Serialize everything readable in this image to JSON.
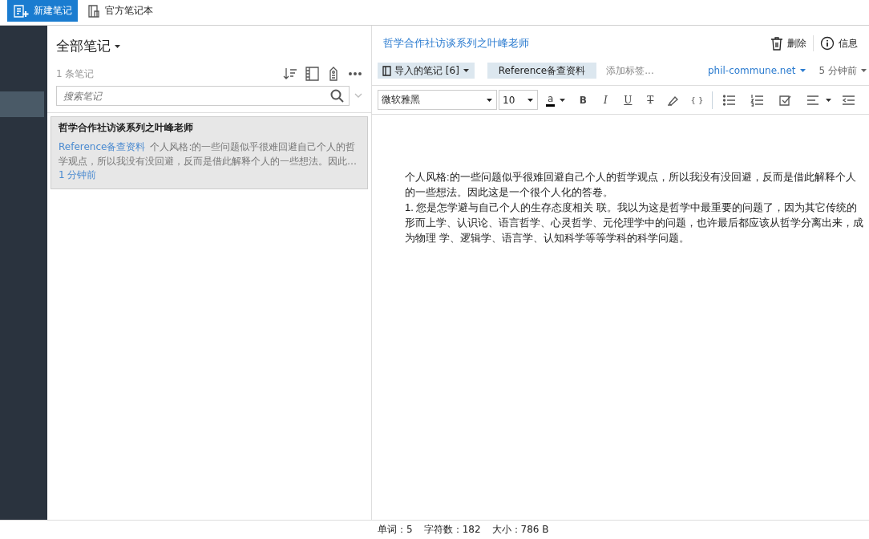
{
  "toolbar": {
    "new_note": "新建笔记",
    "notebooks": "官方笔记本"
  },
  "sidebar": {
    "items": [
      {
        "selected": true
      }
    ]
  },
  "note_list": {
    "title": "全部笔记",
    "count": "1 条笔记",
    "search": {
      "placeholder": "搜索笔记"
    },
    "notes": [
      {
        "title": "哲学合作社访谈系列之叶峰老师",
        "tag": "Reference备查资料",
        "snippet": "个人风格:的一些问题似乎很难回避自己个人的哲学观点，所以我没有没回避，反而是借此解释个人的一些想法。因此…",
        "time": "1 分钟前",
        "selected": true
      }
    ]
  },
  "editor": {
    "title": "哲学合作社访谈系列之叶峰老师",
    "delete": "删除",
    "info": "信息",
    "notebook": "导入的笔记 [6]",
    "tags": [
      "Reference备查资料"
    ],
    "add_tag": "添加标签...",
    "source": "phil-commune.net",
    "time": "5 分钟前",
    "format": {
      "font": "微软雅黑",
      "size": "10",
      "color_letter": "a",
      "bold": "B",
      "italic": "I",
      "underline": "U",
      "strike": "T",
      "code": "{ }"
    },
    "body": [
      "个人风格:的一些问题似乎很难回避自己个人的哲学观点，所以我没有没回避，反而是借此解释个人的一些想法。因此这是一个很个人化的答卷。",
      "1. 您是怎学避与自己个人的生存态度相关 联。我以为这是哲学中最重要的问题了，因为其它传统的形而上学、认识论、语言哲学、心灵哲学、元伦理学中的问题，也许最后都应该从哲学分离出来，成为物理 学、逻辑学、语言学、认知科学等等学科的科学问题。"
    ]
  },
  "status_bar": [
    "单词：5",
    "字符数：182",
    "大小：786 B"
  ]
}
